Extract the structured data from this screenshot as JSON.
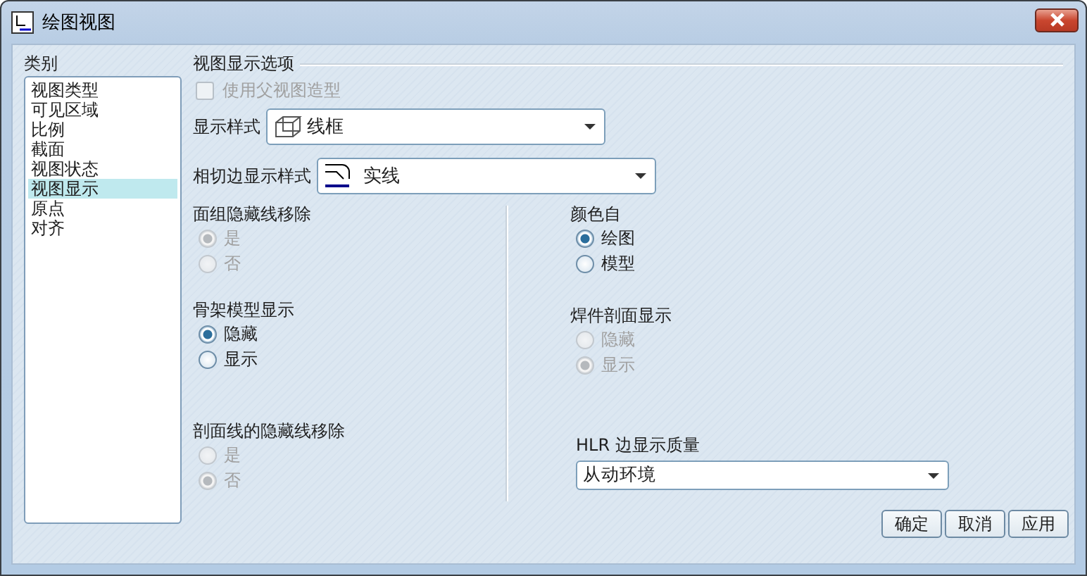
{
  "window": {
    "title": "绘图视图"
  },
  "category": {
    "label": "类别",
    "items": [
      {
        "label": "视图类型",
        "selected": false
      },
      {
        "label": "可见区域",
        "selected": false
      },
      {
        "label": "比例",
        "selected": false
      },
      {
        "label": "截面",
        "selected": false
      },
      {
        "label": "视图状态",
        "selected": false
      },
      {
        "label": "视图显示",
        "selected": true
      },
      {
        "label": "原点",
        "selected": false
      },
      {
        "label": "对齐",
        "selected": false
      }
    ]
  },
  "options": {
    "title": "视图显示选项",
    "use_parent": {
      "label": "使用父视图造型",
      "checked": false,
      "disabled": true
    },
    "display_style": {
      "label": "显示样式",
      "value": "线框"
    },
    "tangent_style": {
      "label": "相切边显示样式",
      "value": "实线"
    }
  },
  "left_groups": [
    {
      "title": "面组隐藏线移除",
      "disabled": true,
      "options": [
        {
          "label": "是",
          "selected": true
        },
        {
          "label": "否",
          "selected": false
        }
      ]
    },
    {
      "title": "骨架模型显示",
      "disabled": false,
      "options": [
        {
          "label": "隐藏",
          "selected": true
        },
        {
          "label": "显示",
          "selected": false
        }
      ]
    },
    {
      "title": "剖面线的隐藏线移除",
      "disabled": true,
      "options": [
        {
          "label": "是",
          "selected": false
        },
        {
          "label": "否",
          "selected": true
        }
      ]
    }
  ],
  "right_groups": [
    {
      "title": "颜色自",
      "disabled": false,
      "options": [
        {
          "label": "绘图",
          "selected": true
        },
        {
          "label": "模型",
          "selected": false
        }
      ]
    },
    {
      "title": "焊件剖面显示",
      "disabled": true,
      "options": [
        {
          "label": "隐藏",
          "selected": false
        },
        {
          "label": "显示",
          "selected": true
        }
      ]
    }
  ],
  "hlr": {
    "label": "HLR 边显示质量",
    "value": "从动环境"
  },
  "buttons": [
    "确定",
    "取消",
    "应用"
  ]
}
